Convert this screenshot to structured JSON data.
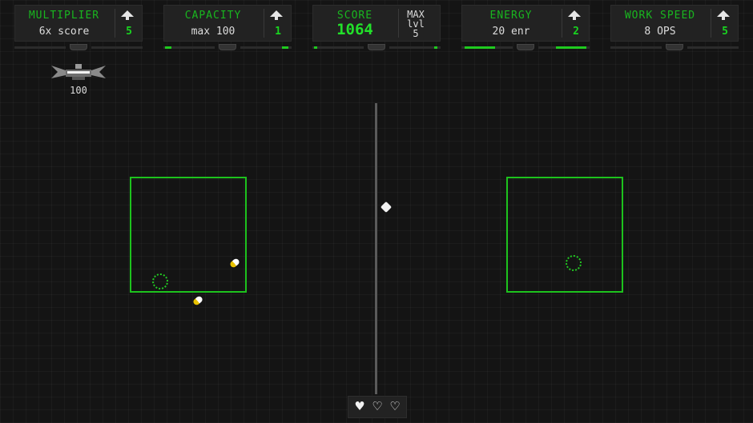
{
  "stats": {
    "multiplier": {
      "title": "MULTIPLIER",
      "value": "6x score",
      "level": "5",
      "bar_fraction": 0.0
    },
    "capacity": {
      "title": "CAPACITY",
      "value": "max 100",
      "level": "1",
      "bar_fraction": 0.12
    },
    "score": {
      "title": "SCORE",
      "value": "1064",
      "max_lines": [
        "MAX",
        "lvl",
        "5"
      ],
      "bar_fraction": 0.04
    },
    "energy": {
      "title": "ENERGY",
      "value": "20 enr",
      "level": "2",
      "bar_fraction": 0.3
    },
    "work_speed": {
      "title": "WORK SPEED",
      "value": "8 OPS",
      "level": "5",
      "bar_fraction": 0.0
    }
  },
  "ship": {
    "icon": "ship-icon",
    "count": "100"
  },
  "lives": {
    "total": 3,
    "remaining": 1,
    "full_icon": "heart-full-icon",
    "empty_icon": "heart-empty-icon"
  },
  "colors": {
    "accent": "#1dc21d",
    "background": "#141414",
    "panel": "#222222",
    "text": "#dcdcdc"
  }
}
